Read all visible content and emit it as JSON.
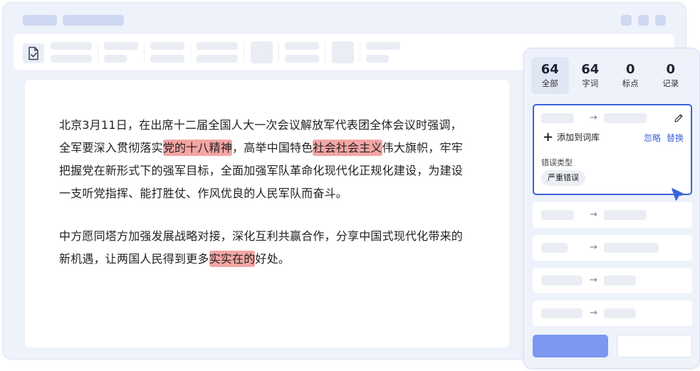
{
  "colors": {
    "accent": "#3d63d9",
    "highlight": "#f3a6a4",
    "primary_button": "#7b98f0",
    "placeholder": "#cfd8f2"
  },
  "toolbar": {
    "first_icon": "document-check-icon"
  },
  "editor": {
    "paragraphs": [
      [
        {
          "text": "北京3月11日，在出席十二届全国人大一次会议解放军代表团全体会议时强调，全军要深入贯彻落实",
          "hl": false
        },
        {
          "text": "党的十八精神",
          "hl": true
        },
        {
          "text": "，高举中国特色",
          "hl": false
        },
        {
          "text": "社会社会主义",
          "hl": true
        },
        {
          "text": "伟大旗帜，牢牢把握党在新形式下的强军目标，全面加强军队革命化现代化正规化建设，为建设一支听党指挥、能打胜仗、作风优良的人民军队而奋斗。",
          "hl": false
        }
      ],
      [
        {
          "text": "中方愿同塔方加强发展战略对接，深化互利共赢合作，分享中国式现代化带来的新机遇，让两国人民得到更多",
          "hl": false
        },
        {
          "text": "实实在的",
          "hl": true
        },
        {
          "text": "好处。",
          "hl": false
        }
      ]
    ]
  },
  "panel": {
    "stats": [
      {
        "num": "64",
        "label": "全部",
        "active": true
      },
      {
        "num": "64",
        "label": "字词",
        "active": false
      },
      {
        "num": "0",
        "label": "标点",
        "active": false
      },
      {
        "num": "0",
        "label": "记录",
        "active": false
      }
    ],
    "selected_card": {
      "add_to_lib": "添加到词库",
      "ignore": "忽略",
      "replace": "替换",
      "error_type_label": "错误类型",
      "error_type_tag": "严重错误",
      "arrow": "→"
    },
    "other_cards_arrow": "→"
  }
}
